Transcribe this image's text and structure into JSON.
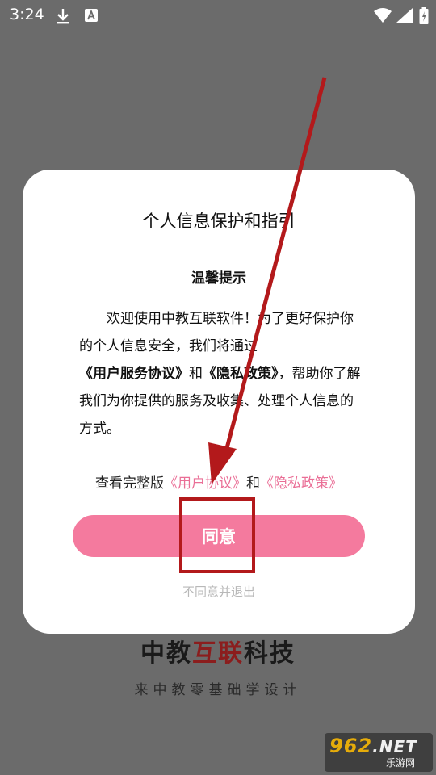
{
  "status_bar": {
    "time": "3:24",
    "icons": [
      "download-icon",
      "a-icon",
      "wifi-icon",
      "signal-icon",
      "battery-icon"
    ],
    "color": "#ffffff"
  },
  "background": {
    "brand_part1": "中教",
    "brand_part2": "互联",
    "brand_part3": "科技",
    "slogan": "来中教零基础学设计"
  },
  "dialog": {
    "title": "个人信息保护和指引",
    "subtitle": "温馨提示",
    "body_intro": "欢迎使用中教互联软件！为了更好保护你的个人信息安全，我们将通过",
    "body_link1": "《用户服务协议》",
    "body_and": "和",
    "body_link2": "《隐私政策》",
    "body_rest": "，帮助你了解我们为你提供的服务及收集、处理个人信息的方式。",
    "view_prefix": "查看完整版",
    "view_link1": "《用户协议》",
    "view_and": "和",
    "view_link2": "《隐私政策》",
    "agree_label": "同意",
    "disagree_label": "不同意并退出",
    "accent_color": "#f47a9e",
    "link_color": "#ea6e96"
  },
  "watermark": {
    "logo": "962",
    "logo_suffix": ".NET",
    "sub": "乐游网"
  },
  "annotation": {
    "color": "#b3191b"
  }
}
